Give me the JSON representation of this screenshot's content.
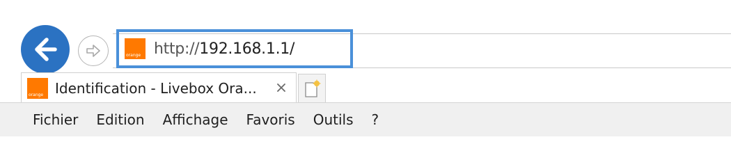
{
  "navigation": {
    "back_icon": "arrow-left-icon",
    "forward_icon": "arrow-right-outline-icon",
    "accent_color": "#2b72c2"
  },
  "address_bar": {
    "url_scheme": "http://",
    "url_host": "192.168.1.1/",
    "favicon": {
      "brand_text": "orange",
      "color": "#ff7900"
    },
    "highlight_color": "#4a90d9"
  },
  "tabs": [
    {
      "title": "Identification - Livebox Ora...",
      "close_glyph": "✕",
      "active": true
    }
  ],
  "new_tab_icon": "new-tab-icon",
  "menu": {
    "items": [
      "Fichier",
      "Edition",
      "Affichage",
      "Favoris",
      "Outils",
      "?"
    ]
  }
}
